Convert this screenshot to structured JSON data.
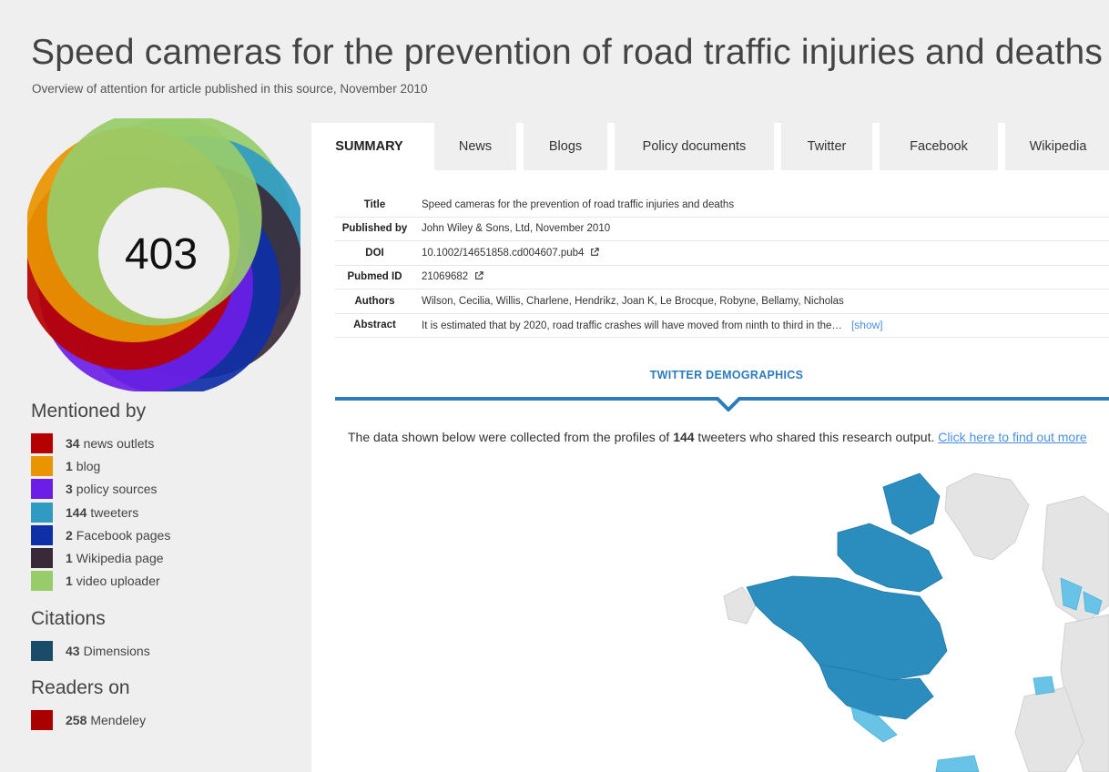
{
  "header": {
    "title": "Speed cameras for the prevention of road traffic injuries and deaths",
    "subtitle": "Overview of attention for article published in this source, November 2010"
  },
  "score": "403",
  "colors": {
    "news": "#b60000",
    "blog": "#e89500",
    "policy": "#6d1ee6",
    "twitter": "#2f9bc2",
    "facebook": "#0f2fa8",
    "wikipedia": "#3a2a38",
    "video": "#98cc6a",
    "dimensions": "#1a4b68",
    "mendeley": "#a90000",
    "accent_blue": "#2b7bbd"
  },
  "mentioned_by": {
    "heading": "Mentioned by",
    "items": [
      {
        "count": "34",
        "label": "news outlets"
      },
      {
        "count": "1",
        "label": "blog"
      },
      {
        "count": "3",
        "label": "policy sources"
      },
      {
        "count": "144",
        "label": "tweeters"
      },
      {
        "count": "2",
        "label": "Facebook pages"
      },
      {
        "count": "1",
        "label": "Wikipedia page"
      },
      {
        "count": "1",
        "label": "video uploader"
      }
    ]
  },
  "citations": {
    "heading": "Citations",
    "items": [
      {
        "count": "43",
        "label": "Dimensions"
      }
    ]
  },
  "readers": {
    "heading": "Readers on",
    "items": [
      {
        "count": "258",
        "label": "Mendeley"
      }
    ]
  },
  "tabs": [
    "SUMMARY",
    "News",
    "Blogs",
    "Policy documents",
    "Twitter",
    "Facebook",
    "Wikipedia"
  ],
  "summary": {
    "rows": [
      {
        "label": "Title",
        "value": "Speed cameras for the prevention of road traffic injuries and deaths"
      },
      {
        "label": "Published by",
        "value": "John Wiley & Sons, Ltd, November 2010"
      },
      {
        "label": "DOI",
        "value": "10.1002/14651858.cd004607.pub4"
      },
      {
        "label": "Pubmed ID",
        "value": "21069682"
      },
      {
        "label": "Authors",
        "value": "Wilson, Cecilia, Willis, Charlene, Hendrikz, Joan K, Le Brocque, Robyne, Bellamy, Nicholas"
      },
      {
        "label": "Abstract",
        "value": "It is estimated that by 2020, road traffic crashes will have moved from ninth to third in the…"
      }
    ],
    "show_link": "[show]"
  },
  "twitter_demographics": {
    "heading": "TWITTER DEMOGRAPHICS",
    "text_before": "The data shown below were collected from the profiles of ",
    "count": "144",
    "text_after": " tweeters who shared this research output. ",
    "link": "Click here to find out more"
  }
}
